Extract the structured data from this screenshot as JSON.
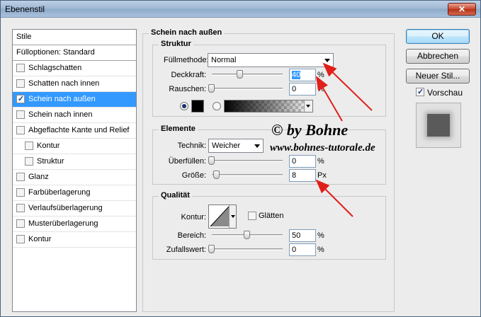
{
  "window": {
    "title": "Ebenenstil",
    "close": "✕"
  },
  "sidebar": {
    "header": "Stile",
    "blend_options": "Fülloptionen: Standard",
    "items": [
      {
        "label": "Schlagschatten",
        "checked": false
      },
      {
        "label": "Schatten nach innen",
        "checked": false
      },
      {
        "label": "Schein nach außen",
        "checked": true,
        "selected": true
      },
      {
        "label": "Schein nach innen",
        "checked": false
      },
      {
        "label": "Abgeflachte Kante und Relief",
        "checked": false
      },
      {
        "label": "Kontur",
        "checked": false,
        "sub": true
      },
      {
        "label": "Struktur",
        "checked": false,
        "sub": true
      },
      {
        "label": "Glanz",
        "checked": false
      },
      {
        "label": "Farbüberlagerung",
        "checked": false
      },
      {
        "label": "Verlaufsüberlagerung",
        "checked": false
      },
      {
        "label": "Musterüberlagerung",
        "checked": false
      },
      {
        "label": "Kontur",
        "checked": false
      }
    ]
  },
  "panel": {
    "title": "Schein nach außen",
    "structure": {
      "title": "Struktur",
      "blend_mode_label": "Füllmethode:",
      "blend_mode_value": "Normal",
      "opacity_label": "Deckkraft:",
      "opacity_value": "40",
      "opacity_unit": "%",
      "noise_label": "Rauschen:",
      "noise_value": "0",
      "noise_unit": "%",
      "color": "#000000"
    },
    "elements": {
      "title": "Elemente",
      "technique_label": "Technik:",
      "technique_value": "Weicher",
      "spread_label": "Überfüllen:",
      "spread_value": "0",
      "spread_unit": "%",
      "size_label": "Größe:",
      "size_value": "8",
      "size_unit": "Px"
    },
    "quality": {
      "title": "Qualität",
      "contour_label": "Kontur:",
      "antialias_label": "Glätten",
      "range_label": "Bereich:",
      "range_value": "50",
      "range_unit": "%",
      "jitter_label": "Zufallswert:",
      "jitter_value": "0",
      "jitter_unit": "%"
    }
  },
  "buttons": {
    "ok": "OK",
    "cancel": "Abbrechen",
    "new_style": "Neuer Stil...",
    "preview_label": "Vorschau"
  },
  "watermark": {
    "line1": "© by Bohne",
    "line2": "www.bohnes-tutorale.de"
  },
  "colors": {
    "arrow": "#e0201a",
    "selection": "#3399ff"
  }
}
